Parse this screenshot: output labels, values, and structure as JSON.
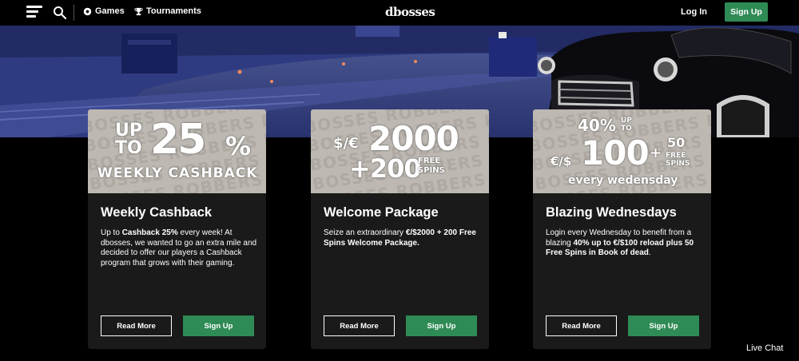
{
  "header": {
    "nav": {
      "games": "Games",
      "tournaments": "Tournaments"
    },
    "logo": "dbosses",
    "login": "Log In",
    "signup": "Sign Up"
  },
  "cards": [
    {
      "banner": {
        "line1": "UP",
        "line2": "TO",
        "big": "25",
        "pct": "%",
        "sub": "WEEKLY CASHBACK",
        "bg_text": "DBOSSES ROBBERS BAR"
      },
      "title": "Weekly Cashback",
      "desc_pre": "Up to ",
      "desc_bold": "Cashback 25%",
      "desc_post": " every week! At dbosses, we wanted to go an extra mile and decided to offer our players a Cashback program that grows with their gaming.",
      "read_more": "Read More",
      "sign_up": "Sign Up"
    },
    {
      "banner": {
        "cur": "$/€",
        "big": "2000",
        "plus": "+200",
        "free": "FREE",
        "spins": "SPINS",
        "bg_text": "DBOSSES ROBBERS BAR"
      },
      "title": "Welcome Package",
      "desc_pre": "Seize an extraordinary ",
      "desc_bold": "€/$2000 + 200 Free Spins Welcome Package.",
      "desc_post": "",
      "read_more": "Read More",
      "sign_up": "Sign Up"
    },
    {
      "banner": {
        "pct": "40%",
        "up": "UP",
        "to": "TO",
        "cur": "€/$",
        "big": "100",
        "plus": "+",
        "fifty": "50",
        "free": "FREE",
        "spins": "SPINS",
        "sub": "every wedensday",
        "bg_text": "DBOSSES ROBBERS BAR"
      },
      "title": "Blazing Wednesdays",
      "desc_pre": "Login every Wednesday to benefit from a blazing ",
      "desc_bold": "40% up to €/$100 reload plus 50 Free Spins in Book of dead",
      "desc_post": ".",
      "read_more": "Read More",
      "sign_up": "Sign Up"
    }
  ],
  "live_chat": "Live Chat",
  "colors": {
    "accent_green": "#2f8b55",
    "card_bg": "#1a1a1a",
    "banner_bg": "#bdb8b1"
  }
}
